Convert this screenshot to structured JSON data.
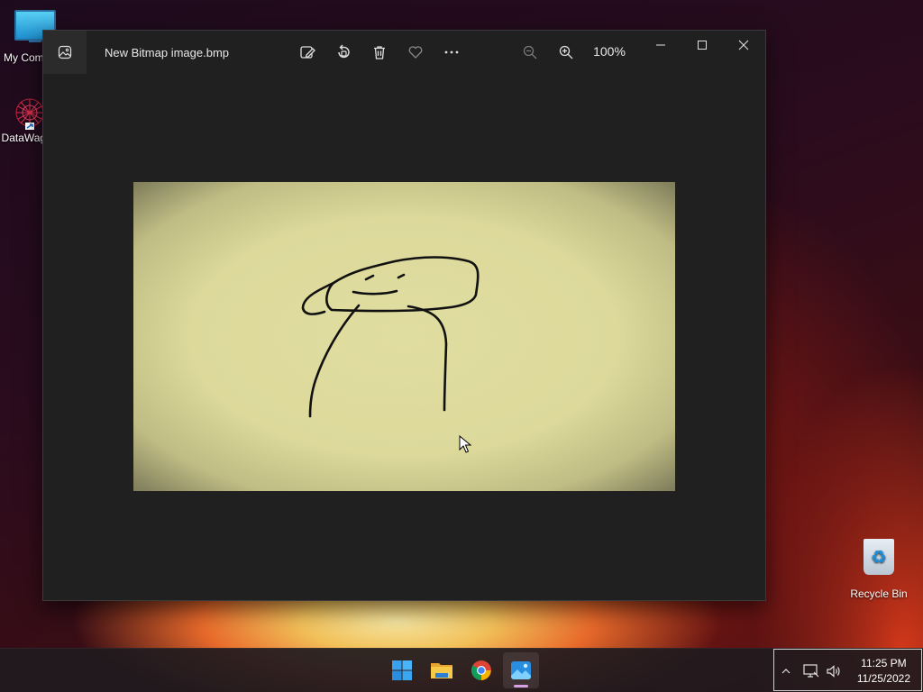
{
  "desktop": {
    "icons": [
      {
        "label": "My Computer",
        "icon": "computer-icon"
      },
      {
        "label": "DataWagon",
        "icon": "datawagon-icon"
      },
      {
        "label": "Recycle Bin",
        "icon": "recycle-bin-icon"
      }
    ]
  },
  "photos_window": {
    "title": "New Bitmap image.bmp",
    "zoom": "100%",
    "toolbar": [
      {
        "name": "edit-image",
        "icon": "edit-image-icon"
      },
      {
        "name": "rotate",
        "icon": "rotate-icon"
      },
      {
        "name": "delete",
        "icon": "trash-icon"
      },
      {
        "name": "favorite",
        "icon": "heart-icon"
      },
      {
        "name": "more",
        "icon": "more-icon"
      },
      {
        "name": "zoom-out",
        "icon": "zoom-out-icon"
      },
      {
        "name": "zoom-in",
        "icon": "zoom-in-icon"
      }
    ],
    "window_controls": [
      "minimize",
      "maximize",
      "close"
    ]
  },
  "taskbar": {
    "apps": [
      {
        "name": "start",
        "icon": "windows-start-icon"
      },
      {
        "name": "file-explorer",
        "icon": "folder-icon"
      },
      {
        "name": "chrome",
        "icon": "chrome-icon"
      },
      {
        "name": "photos",
        "icon": "photos-icon",
        "active": true
      }
    ],
    "tray": {
      "time": "11:25 PM",
      "date": "11/25/2022"
    }
  },
  "colors": {
    "window_bg": "#202020",
    "image_bg": "#dcd99b",
    "active_indicator": "#d7a1e8"
  }
}
